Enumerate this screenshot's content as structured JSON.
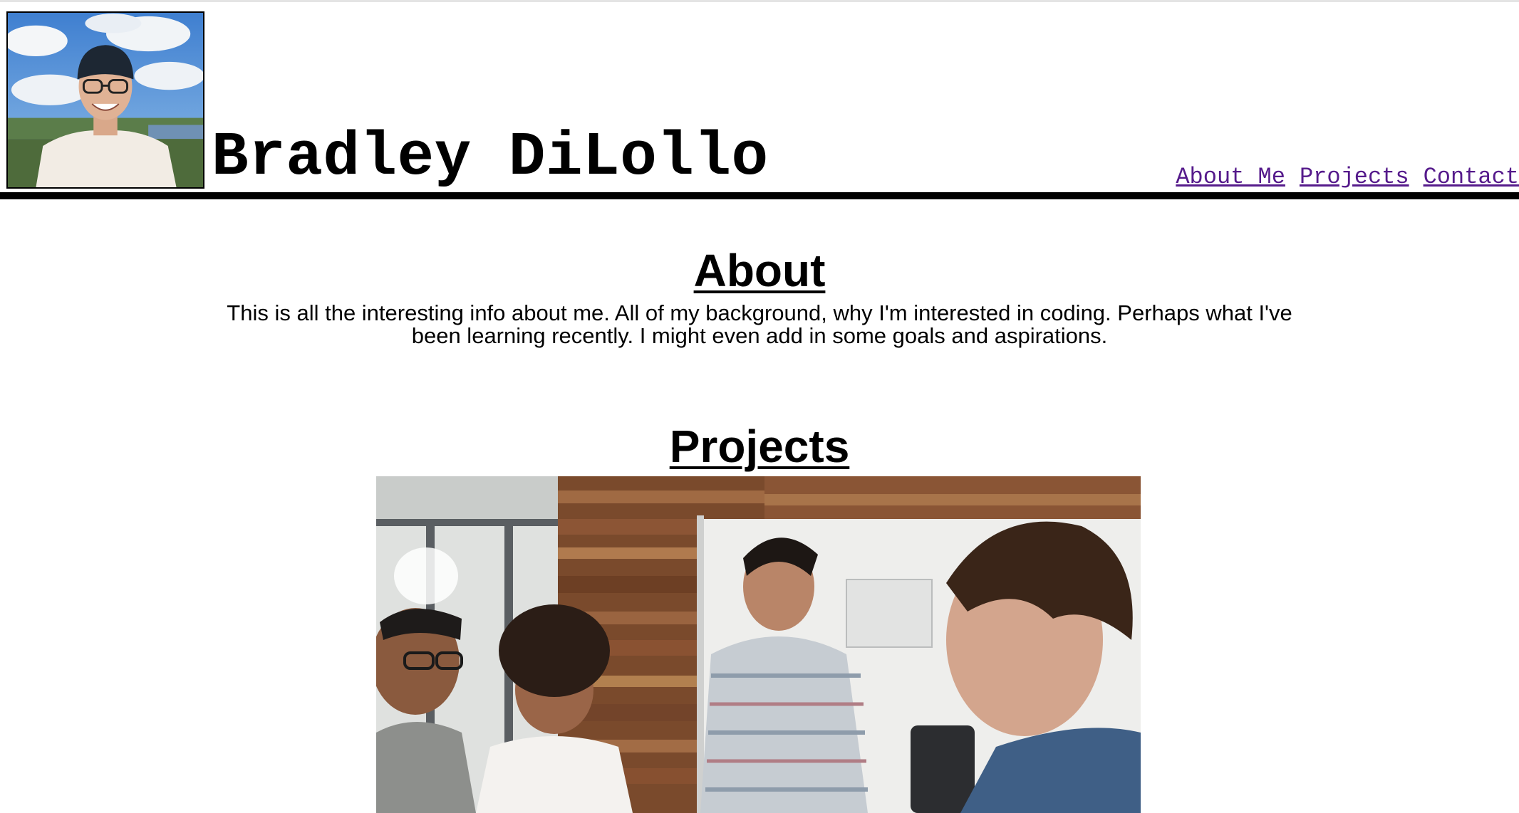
{
  "header": {
    "title": "Bradley DiLollo",
    "avatar_icon": "profile-photo",
    "nav": [
      {
        "label": "About Me"
      },
      {
        "label": "Projects"
      },
      {
        "label": "Contact"
      }
    ]
  },
  "about": {
    "heading": "About",
    "text": "This is all the interesting info about me. All of my background, why I'm interested in coding. Perhaps what I've been learning recently. I might even add in some goals and aspirations."
  },
  "projects": {
    "heading": "Projects",
    "image_icon": "team-meeting-photo"
  },
  "colors": {
    "link_visited": "#551a8b",
    "rule": "#000000",
    "background": "#ffffff"
  }
}
